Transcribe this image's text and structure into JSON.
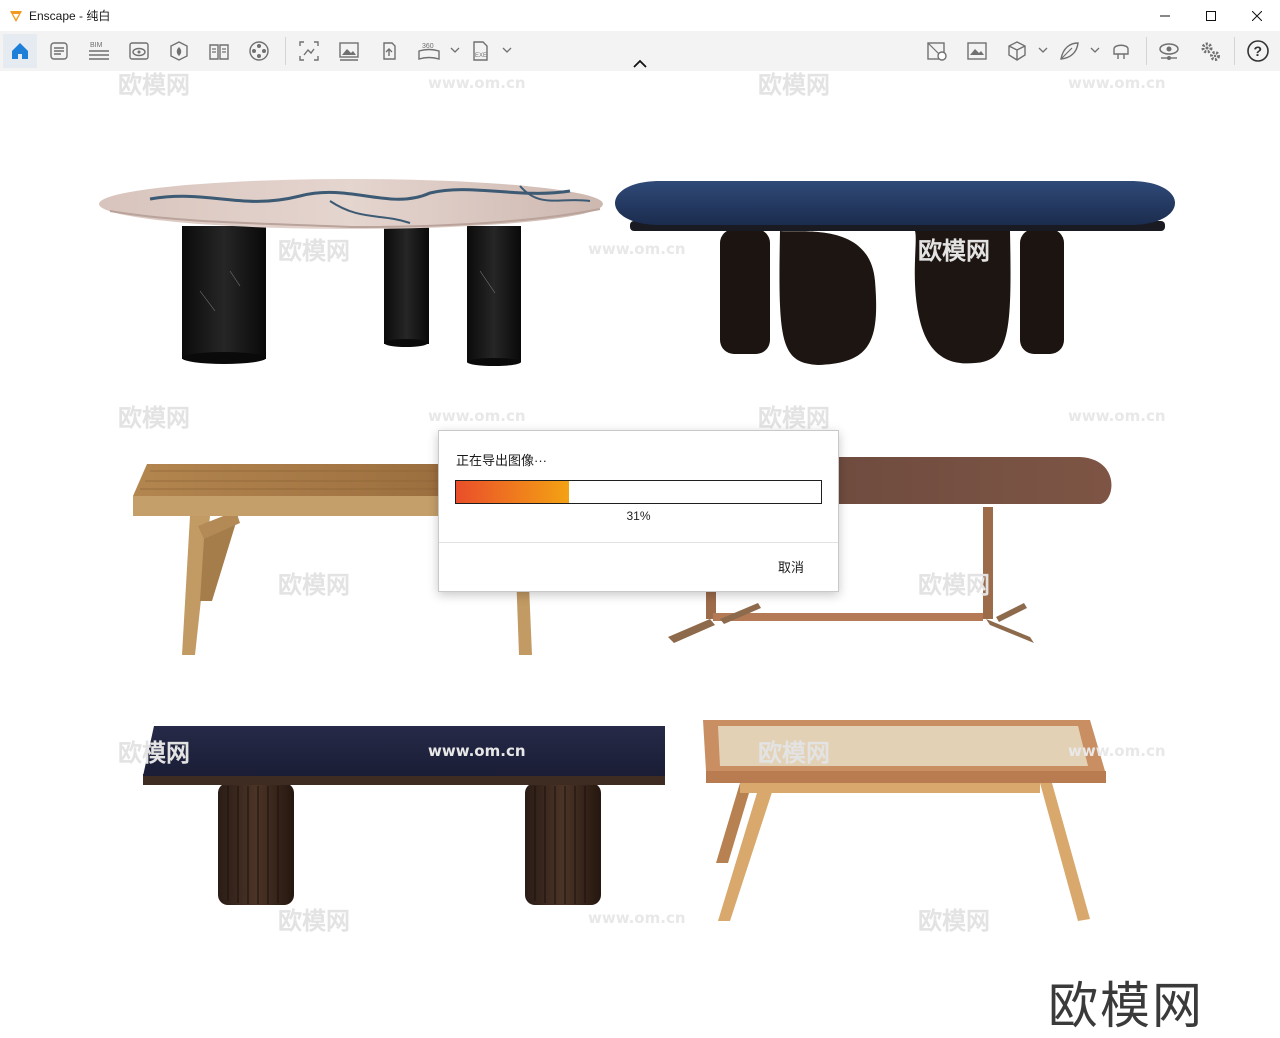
{
  "window": {
    "title": "Enscape - 纯白"
  },
  "toolbar": {
    "items": [
      {
        "name": "home-icon"
      },
      {
        "name": "document-icon"
      },
      {
        "name": "bim-icon",
        "label": "BIM"
      },
      {
        "name": "eye-view-icon"
      },
      {
        "name": "asset-library-icon"
      },
      {
        "name": "book-icon"
      },
      {
        "name": "film-reel-icon"
      },
      {
        "name": "screenshot-icon"
      },
      {
        "name": "image-icon"
      },
      {
        "name": "upload-icon"
      },
      {
        "name": "panorama-360-icon",
        "label": "360"
      },
      {
        "name": "exe-export-icon",
        "label": "EXE"
      },
      {
        "name": "map-icon"
      },
      {
        "name": "landscape-icon"
      },
      {
        "name": "cube-icon"
      },
      {
        "name": "leaf-icon"
      },
      {
        "name": "vr-headset-icon"
      },
      {
        "name": "visual-settings-eye-icon"
      },
      {
        "name": "settings-gears-icon"
      },
      {
        "name": "help-icon"
      }
    ]
  },
  "viewport": {
    "watermark_text": "欧模网",
    "watermark_url": "www.om.cn",
    "brand_logo_text": "欧模网"
  },
  "dialog": {
    "message": "正在导出图像···",
    "progress": 0.31,
    "progress_label": "31%",
    "cancel_label": "取消"
  },
  "colors": {
    "accent": "#1e7fd8",
    "progress_start": "#ea4e2a",
    "progress_end": "#f4a213"
  }
}
